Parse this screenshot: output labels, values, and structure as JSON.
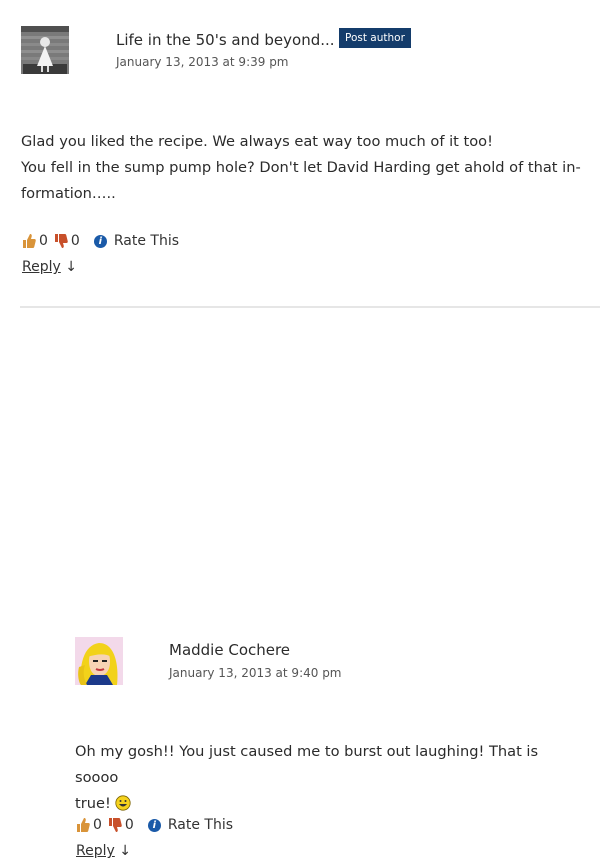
{
  "comments": [
    {
      "author": "Life in the 50's and beyond...",
      "badge": "Post author",
      "date": "January 13, 2013 at 9:39 pm",
      "lines": [
        "Glad you liked the recipe. We always eat way too much of it too!",
        "You fell in the sump pump hole? Don't let David Harding get ahold of that in-",
        "formation….."
      ],
      "likes": "0",
      "dislikes": "0",
      "rate_label": "Rate This",
      "reply_label": "Reply",
      "reply_arrow": "↓"
    },
    {
      "author": "Maddie Cochere",
      "date": "January 13, 2013 at 9:40 pm",
      "lines": [
        "Oh my gosh!! You just caused me to burst out laughing! That is soooo",
        "true!"
      ],
      "likes": "0",
      "dislikes": "0",
      "rate_label": "Rate This",
      "reply_label": "Reply",
      "reply_arrow": "↓"
    }
  ],
  "colors": {
    "badge_bg": "#143c6b",
    "rate_icon": "#1a5aa8",
    "thumb_up": "#d9943a",
    "thumb_down": "#c8502a"
  },
  "icons": {
    "thumb_up": "thumbs-up-icon",
    "thumb_down": "thumbs-down-icon",
    "rate": "info-icon",
    "smiley": "smiley-icon"
  }
}
